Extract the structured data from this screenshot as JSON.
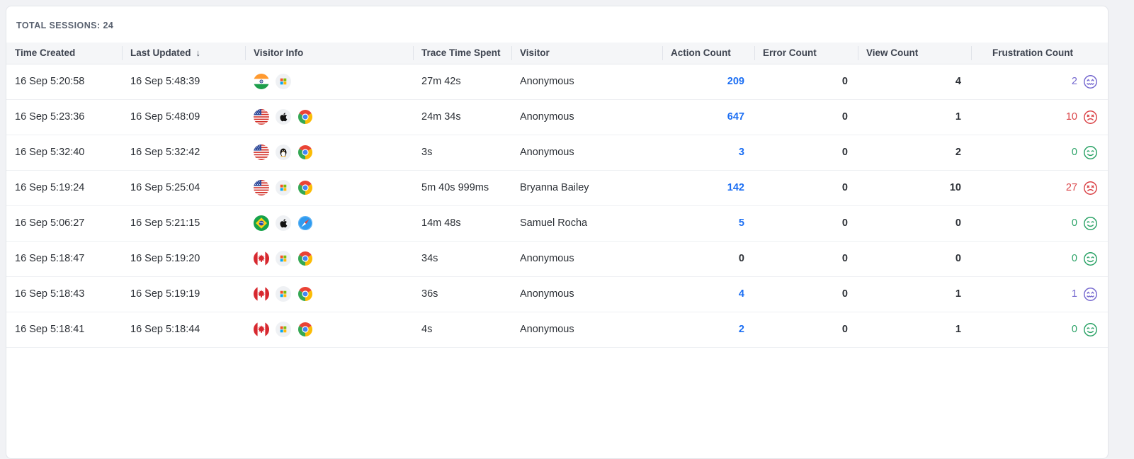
{
  "summary": {
    "total_sessions": "TOTAL SESSIONS: 24"
  },
  "table": {
    "columns": [
      {
        "key": "time_created",
        "label": "Time Created"
      },
      {
        "key": "last_updated",
        "label": "Last Updated",
        "sort_icon": "arrow-down"
      },
      {
        "key": "visitor_info",
        "label": "Visitor Info"
      },
      {
        "key": "trace_time_spent",
        "label": "Trace Time Spent"
      },
      {
        "key": "visitor",
        "label": "Visitor"
      },
      {
        "key": "action_count",
        "label": "Action Count"
      },
      {
        "key": "error_count",
        "label": "Error Count"
      },
      {
        "key": "view_count",
        "label": "View Count"
      },
      {
        "key": "frustration_count",
        "label": "Frustration Count"
      }
    ],
    "rows": [
      {
        "time_created": "16 Sep 5:20:58",
        "last_updated": "16 Sep 5:48:39",
        "visitor_info_icons": [
          "flag-india",
          "os-windows"
        ],
        "trace_time_spent": "27m 42s",
        "visitor": "Anonymous",
        "action_count": "209",
        "error_count": "0",
        "view_count": "4",
        "frustration_count": "2",
        "frustration_mood": "grimace"
      },
      {
        "time_created": "16 Sep 5:23:36",
        "last_updated": "16 Sep 5:48:09",
        "visitor_info_icons": [
          "flag-us",
          "os-mac",
          "browser-chrome"
        ],
        "trace_time_spent": "24m 34s",
        "visitor": "Anonymous",
        "action_count": "647",
        "error_count": "0",
        "view_count": "1",
        "frustration_count": "10",
        "frustration_mood": "sad"
      },
      {
        "time_created": "16 Sep 5:32:40",
        "last_updated": "16 Sep 5:32:42",
        "visitor_info_icons": [
          "flag-us",
          "os-linux",
          "browser-chrome"
        ],
        "trace_time_spent": "3s",
        "visitor": "Anonymous",
        "action_count": "3",
        "error_count": "0",
        "view_count": "2",
        "frustration_count": "0",
        "frustration_mood": "happy"
      },
      {
        "time_created": "16 Sep 5:19:24",
        "last_updated": "16 Sep 5:25:04",
        "visitor_info_icons": [
          "flag-us",
          "os-windows",
          "browser-chrome"
        ],
        "trace_time_spent": "5m 40s 999ms",
        "visitor": "Bryanna Bailey",
        "action_count": "142",
        "error_count": "0",
        "view_count": "10",
        "frustration_count": "27",
        "frustration_mood": "sad"
      },
      {
        "time_created": "16 Sep 5:06:27",
        "last_updated": "16 Sep 5:21:15",
        "visitor_info_icons": [
          "flag-brazil",
          "os-mac",
          "browser-safari"
        ],
        "trace_time_spent": "14m 48s",
        "visitor": "Samuel Rocha",
        "action_count": "5",
        "error_count": "0",
        "view_count": "0",
        "frustration_count": "0",
        "frustration_mood": "happy"
      },
      {
        "time_created": "16 Sep 5:18:47",
        "last_updated": "16 Sep 5:19:20",
        "visitor_info_icons": [
          "flag-canada",
          "os-windows",
          "browser-chrome"
        ],
        "trace_time_spent": "34s",
        "visitor": "Anonymous",
        "action_count": "0",
        "error_count": "0",
        "view_count": "0",
        "frustration_count": "0",
        "frustration_mood": "happy"
      },
      {
        "time_created": "16 Sep 5:18:43",
        "last_updated": "16 Sep 5:19:19",
        "visitor_info_icons": [
          "flag-canada",
          "os-windows",
          "browser-chrome"
        ],
        "trace_time_spent": "36s",
        "visitor": "Anonymous",
        "action_count": "4",
        "error_count": "0",
        "view_count": "1",
        "frustration_count": "1",
        "frustration_mood": "grimace"
      },
      {
        "time_created": "16 Sep 5:18:41",
        "last_updated": "16 Sep 5:18:44",
        "visitor_info_icons": [
          "flag-canada",
          "os-windows",
          "browser-chrome"
        ],
        "trace_time_spent": "4s",
        "visitor": "Anonymous",
        "action_count": "2",
        "error_count": "0",
        "view_count": "1",
        "frustration_count": "0",
        "frustration_mood": "happy"
      }
    ]
  },
  "colors": {
    "action_link": "#1b6ef3",
    "frustration_happy": "#2aa266",
    "frustration_sad": "#da4347",
    "frustration_grimace": "#7568cf"
  }
}
